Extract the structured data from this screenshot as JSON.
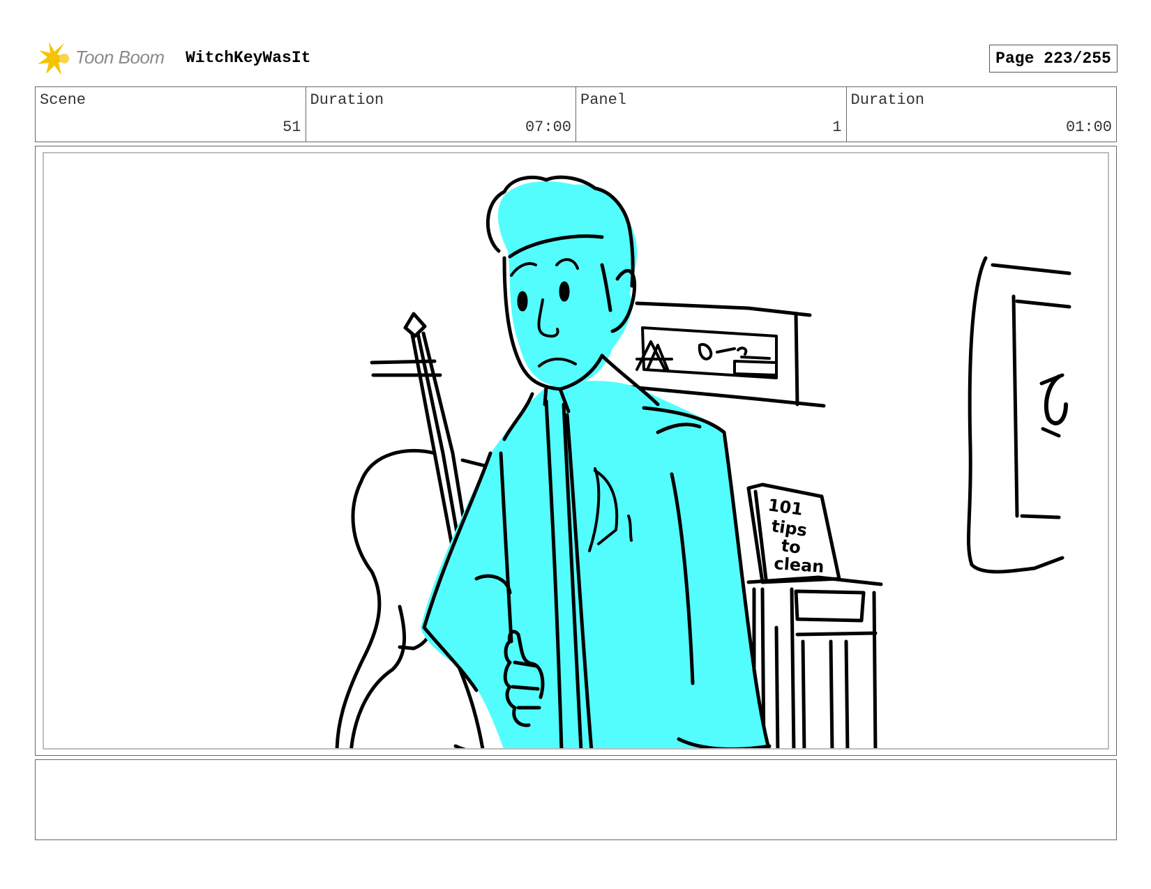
{
  "header": {
    "logo_text": "Toon Boom",
    "project_title": "WitchKeyWasIt",
    "page_label": "Page 223/255"
  },
  "info": {
    "scene_label": "Scene",
    "scene_value": "51",
    "scene_duration_label": "Duration",
    "scene_duration_value": "07:00",
    "panel_label": "Panel",
    "panel_value": "1",
    "panel_duration_label": "Duration",
    "panel_duration_value": "01:00"
  },
  "panel": {
    "book_text": [
      "101",
      "tips",
      "to",
      "clean"
    ],
    "character_fill": "#54fdfd",
    "line_color": "#000000"
  },
  "notes": {
    "text": ""
  }
}
